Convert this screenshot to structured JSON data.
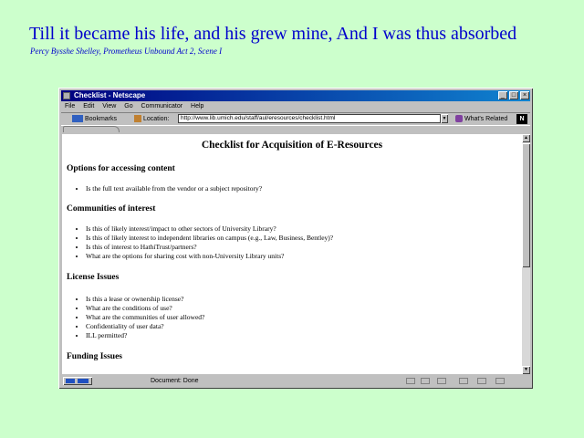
{
  "slide": {
    "title": "Till it became his life, and his grew mine,  And I was thus absorbed",
    "subtitle": "Percy Bysshe Shelley, Prometheus Unbound Act 2, Scene I"
  },
  "browser": {
    "window_title": "Checklist - Netscape",
    "menu": [
      "File",
      "Edit",
      "View",
      "Go",
      "Communicator",
      "Help"
    ],
    "toolbar": {
      "bookmarks_label": "Bookmarks",
      "location_label": "Location:",
      "location_url": "http://www.lib.umich.edu/staff/aul/eresources/checklist.html",
      "related_label": "What's Related"
    },
    "status_text": "Document: Done"
  },
  "document": {
    "title": "Checklist for Acquisition of E-Resources",
    "sections": [
      {
        "heading": "Options for accessing content",
        "items": [
          "Is the full text available from the vendor or a subject repository?"
        ]
      },
      {
        "heading": "Communities of interest",
        "items": [
          "Is this of likely interest/impact to other sectors of University Library?",
          "Is this of likely interest to independent libraries on campus (e.g., Law, Business, Bentley)?",
          "Is this of interest to HathiTrust/partners?",
          "What are the options for sharing cost with non-University Library units?"
        ]
      },
      {
        "heading": "License Issues",
        "items": [
          "Is this a lease or ownership license?",
          "What are the conditions of use?",
          "What are the communities of user allowed?",
          "Confidentiality of user data?",
          "ILL permitted?"
        ]
      },
      {
        "heading": "Funding Issues",
        "items": []
      }
    ]
  }
}
